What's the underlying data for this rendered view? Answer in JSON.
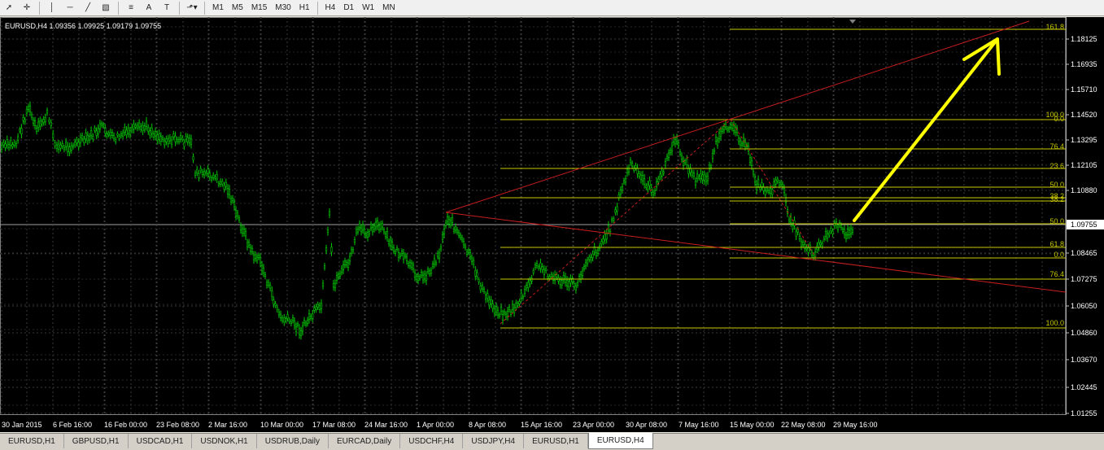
{
  "toolbar": {
    "tools": [
      {
        "name": "cursor-icon",
        "glyph": "➚"
      },
      {
        "name": "crosshair-icon",
        "glyph": "✛"
      },
      {
        "name": "vertical-line-icon",
        "glyph": "│"
      },
      {
        "name": "horizontal-line-icon",
        "glyph": "─"
      },
      {
        "name": "trendline-icon",
        "glyph": "╱"
      },
      {
        "name": "equidistant-channel-icon",
        "glyph": "▧"
      },
      {
        "name": "fibonacci-icon",
        "glyph": "≡"
      },
      {
        "name": "text-icon",
        "glyph": "A"
      },
      {
        "name": "text-label-icon",
        "glyph": "T"
      },
      {
        "name": "arrows-icon",
        "glyph": "⬏▾"
      }
    ],
    "timeframes": [
      "M1",
      "M5",
      "M15",
      "M30",
      "H1",
      "H4",
      "D1",
      "W1",
      "MN"
    ]
  },
  "chart": {
    "title": "EURUSD,H4  1.09356 1.09925 1.09179 1.09755",
    "current_price": "1.09755",
    "price_labels": [
      "1.18125",
      "1.16935",
      "1.15710",
      "1.14520",
      "1.13295",
      "1.12105",
      "1.10880",
      "1.09755",
      "1.08465",
      "1.07275",
      "1.06050",
      "1.04860",
      "1.03670",
      "1.02445",
      "1.01255"
    ],
    "time_labels": [
      "30 Jan 2015",
      "6 Feb 16:00",
      "16 Feb 00:00",
      "23 Feb 08:00",
      "2 Mar 16:00",
      "10 Mar 00:00",
      "17 Mar 08:00",
      "24 Mar 16:00",
      "1 Apr 00:00",
      "8 Apr 08:00",
      "15 Apr 16:00",
      "23 Apr 00:00",
      "30 Apr 08:00",
      "7 May 16:00",
      "15 May 00:00",
      "22 May 08:00",
      "29 May 16:00"
    ],
    "fib_levels_upper": [
      "161.8",
      "100.0",
      "0.0",
      "76.4",
      "23.6",
      "50.0",
      "38.2",
      "38.2",
      "50.0",
      "61.8",
      "0.0"
    ],
    "fib_levels_lower": [
      "76.4",
      "100.0"
    ],
    "colors": {
      "candles": "#00C800",
      "fib": "#C8C800",
      "trend": "#C81E1E",
      "arrow": "#FFFF00",
      "grid": "#3A3A3A"
    }
  },
  "tabs": [
    {
      "label": "EURUSD,H1",
      "active": false
    },
    {
      "label": "GBPUSD,H1",
      "active": false
    },
    {
      "label": "USDCAD,H1",
      "active": false
    },
    {
      "label": "USDNOK,H1",
      "active": false
    },
    {
      "label": "USDRUB,Daily",
      "active": false
    },
    {
      "label": "EURCAD,Daily",
      "active": false
    },
    {
      "label": "USDCHF,H4",
      "active": false
    },
    {
      "label": "USDJPY,H4",
      "active": false
    },
    {
      "label": "EURUSD,H1",
      "active": false
    },
    {
      "label": "EURUSD,H4",
      "active": true
    }
  ]
}
